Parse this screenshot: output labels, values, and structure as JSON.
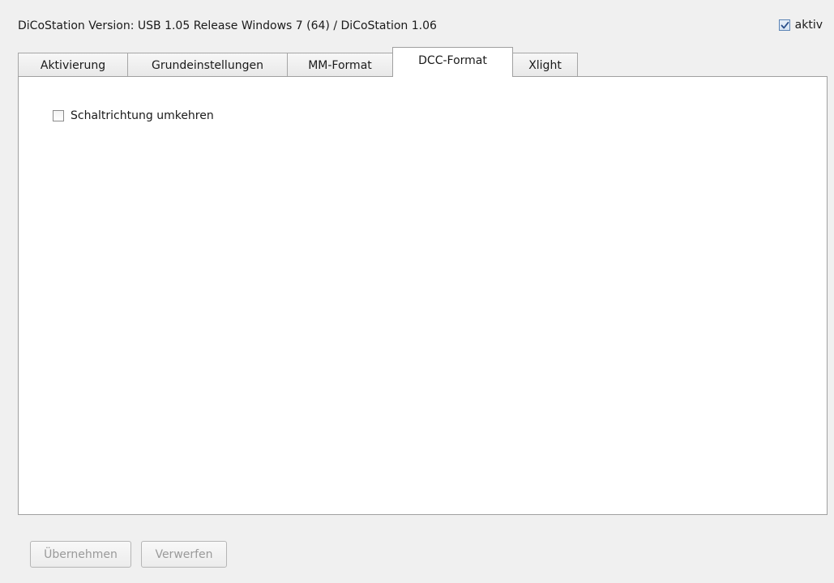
{
  "header": {
    "version_text": "DiCoStation  Version:  USB 1.05 Release Windows 7 (64) / DiCoStation 1.06",
    "aktiv_label": "aktiv",
    "aktiv_checked": true
  },
  "tabs": [
    {
      "label": "Aktivierung",
      "active": false
    },
    {
      "label": "Grundeinstellungen",
      "active": false
    },
    {
      "label": "MM-Format",
      "active": false
    },
    {
      "label": "DCC-Format",
      "active": true
    },
    {
      "label": "Xlight",
      "active": false
    }
  ],
  "panel": {
    "option_label": "Schaltrichtung umkehren",
    "option_checked": false
  },
  "footer": {
    "apply_label": "Übernehmen",
    "discard_label": "Verwerfen"
  },
  "colors": {
    "background": "#f0f0f0",
    "panel": "#ffffff",
    "checkmark": "#2a4f8a",
    "disabled_text": "#9a9a9a"
  },
  "icons": {
    "aktiv_checkbox": "checkbox-checked-icon",
    "option_checkbox": "checkbox-unchecked-icon"
  }
}
